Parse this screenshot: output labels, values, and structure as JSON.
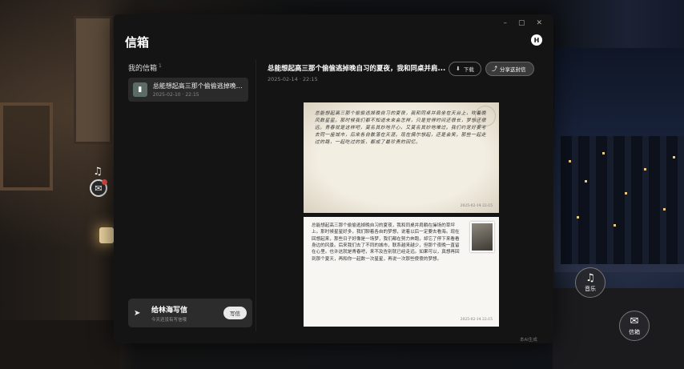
{
  "window": {
    "title": "信箱",
    "avatar_letter": "H",
    "controls": [
      "–",
      "▢",
      "✕"
    ]
  },
  "sidebar": {
    "heading": "我的信箱",
    "count": "1",
    "items": [
      {
        "title": "总能想起高三那个偷偷逃掉晚自习...",
        "date": "2025-02-10 · 22:15"
      }
    ],
    "write_card": {
      "title": "给林海写信",
      "subtitle": "今天还没有写信哦",
      "button": "写信"
    }
  },
  "letter": {
    "title": "总能想起高三那个偷偷逃掉晚自习的夏夜，我和同桌并肩...",
    "date": "2025-02-14 · 22:15",
    "download_label": "下载",
    "share_label": "分享这封信",
    "page1_text": "总能想起高三那个偷偷逃掉晚自习的夏夜，我和同桌并肩坐在天台上，吹着晚风数星星。那时候我们都不知道未来会怎样，只是觉得时间还很长，梦想还很远。青春就是这样吧，莫名其妙地开心，又莫名其妙地难过。我们约定好要考去同一座城市，后来各自散落在天涯。现在偶尔想起，还是会笑。那些一起走过的路，一起吃过的饭，都成了最珍贵的回忆。",
    "page1_date": "2025-02-14 22:15",
    "page2_text": "总能想起高三那个偷偷逃掉晚自习的夏夜，我和同桌并肩躺在操场的草坪上。那时候星星好多，我们聊着各自的梦想，说着以后一定要去看海。现在回想起来，那些日子好像是一场梦，我们都在努力奔跑，却忘了停下来看看身边的风景。后来我们去了不同的城市，联系越来越少，但那个夜晚一直留在心里。也许这就是青春吧，来不及告别就已经走远。如果可以，真想再回到那个夏天，再和你一起数一次星星，再说一次那些傻傻的梦想。",
    "page2_date": "2025-02-14 22:15",
    "footer": "本AI生成"
  },
  "floating": {
    "music_label": "音乐",
    "mailbox_label": "信箱"
  }
}
